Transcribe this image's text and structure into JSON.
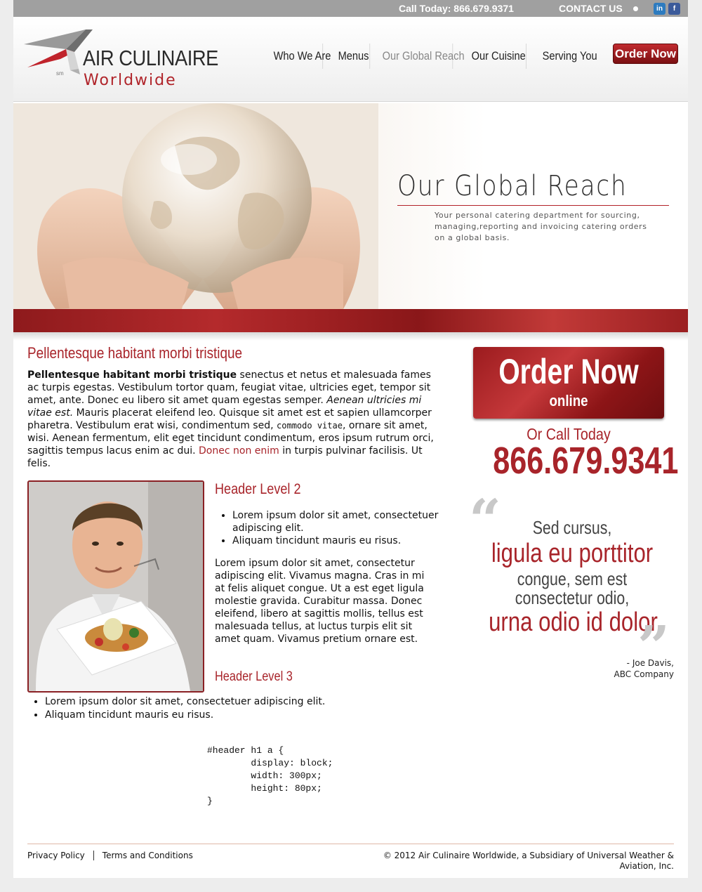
{
  "topbar": {
    "call_label": "Call Today: 866.679.9371",
    "contact_label": "CONTACT US",
    "linkedin_icon": "linkedin-icon",
    "facebook_icon": "facebook-icon",
    "linkedin_text": "in",
    "facebook_text": "f"
  },
  "brand": {
    "name": "AIR CULINAIRE",
    "sub": "Worldwide",
    "sm": "sm",
    "accent": "#a8242a"
  },
  "nav": {
    "items": [
      {
        "label": "Who We Are"
      },
      {
        "label": "Menus"
      },
      {
        "label": "Our Global Reach"
      },
      {
        "label": "Our Cuisine"
      },
      {
        "label": "Serving You"
      }
    ],
    "order_label": "Order Now"
  },
  "hero": {
    "title": "Our Global Reach",
    "subtitle": "Your personal catering department for sourcing, managing,reporting and invoicing catering orders on a global basis."
  },
  "main": {
    "heading": "Pellentesque habitant morbi tristique",
    "intro": {
      "bold_lead": "Pellentesque habitant morbi tristique",
      "text1": " senectus et netus et malesuada fames ac turpis egestas. Vestibulum tortor quam, feugiat vitae, ultricies eget, tempor sit amet, ante. Donec eu libero sit amet quam egestas semper. ",
      "italic": "Aenean ultricies mi vitae est.",
      "text2": " Mauris placerat eleifend leo. Quisque sit amet est et sapien ullamcorper pharetra. Vestibulum erat wisi, condimentum sed, ",
      "code": "commodo vitae",
      "text3": ", ornare sit amet, wisi. Aenean fermentum, elit eget tincidunt condimentum, eros ipsum rutrum orci, sagittis tempus lacus enim ac dui. ",
      "link": "Donec non enim",
      "text4": " in turpis pulvinar facilisis. Ut felis."
    },
    "h2": "Header Level 2",
    "list1": [
      "Lorem ipsum dolor sit amet, consectetuer adipiscing elit.",
      "Aliquam tincidunt mauris eu risus."
    ],
    "para2": "Lorem ipsum dolor sit amet, consectetur adipiscing elit. Vivamus magna. Cras in mi at felis aliquet congue. Ut a est eget ligula molestie gravida. Curabitur massa. Donec eleifend, libero at sagittis mollis, tellus est malesuada tellus, at luctus turpis elit sit amet quam. Vivamus pretium ornare est.",
    "h3": "Header Level 3",
    "list2": [
      "Lorem ipsum dolor sit amet, consectetuer adipiscing elit.",
      "Aliquam tincidunt mauris eu risus."
    ],
    "code": "#header h1 a {\n\tdisplay: block;\n\twidth: 300px;\n\theight: 80px;\n}"
  },
  "sidebar": {
    "order_big": "Order Now",
    "order_online": "online",
    "or_call": "Or Call Today",
    "phone": "866.679.9341",
    "quote": {
      "line1": "Sed cursus,",
      "line2": "ligula eu porttitor",
      "line3": "congue, sem est",
      "line4": "consectetur odio,",
      "line5": "urna odio id dolor.",
      "author": "- Joe Davis,",
      "company": "ABC Company"
    }
  },
  "footer": {
    "privacy": "Privacy Policy",
    "terms": "Terms and Conditions",
    "copyright": "© 2012 Air Culinaire Worldwide, a Subsidiary of Universal Weather & Aviation, Inc."
  }
}
